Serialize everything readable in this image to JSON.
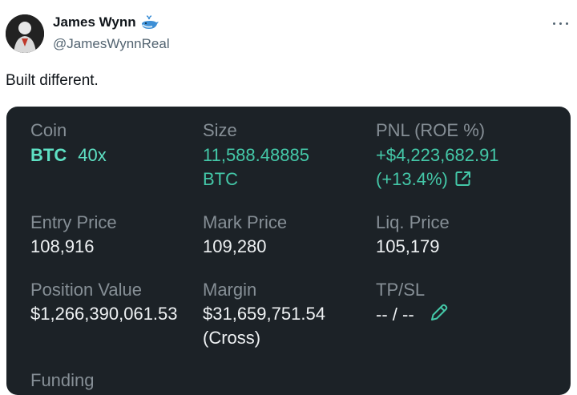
{
  "author": {
    "display_name": "James Wynn",
    "handle": "@JamesWynnReal",
    "avatar_icon": "avatar-silhouette",
    "badge_icon": "whale-emoji"
  },
  "post": {
    "text": "Built different."
  },
  "position_card": {
    "coin_label": "Coin",
    "coin_symbol": "BTC",
    "leverage": "40x",
    "size_label": "Size",
    "size_value_line1": "11,588.48885",
    "size_value_line2": "BTC",
    "pnl_label": "PNL (ROE %)",
    "pnl_value": "+$4,223,682.91",
    "roe_value": "(+13.4%)",
    "entry_label": "Entry Price",
    "entry_value": "108,916",
    "mark_label": "Mark Price",
    "mark_value": "109,280",
    "liq_label": "Liq. Price",
    "liq_value": "105,179",
    "position_value_label": "Position Value",
    "position_value": "$1,266,390,061.53",
    "margin_label": "Margin",
    "margin_value": "$31,659,751.54",
    "margin_mode": "(Cross)",
    "tpsl_label": "TP/SL",
    "tpsl_value": "-- / --",
    "funding_label": "Funding"
  },
  "colors": {
    "card_bg": "#1c2227",
    "accent_green": "#44c8a8",
    "label_gray": "#868f96"
  }
}
